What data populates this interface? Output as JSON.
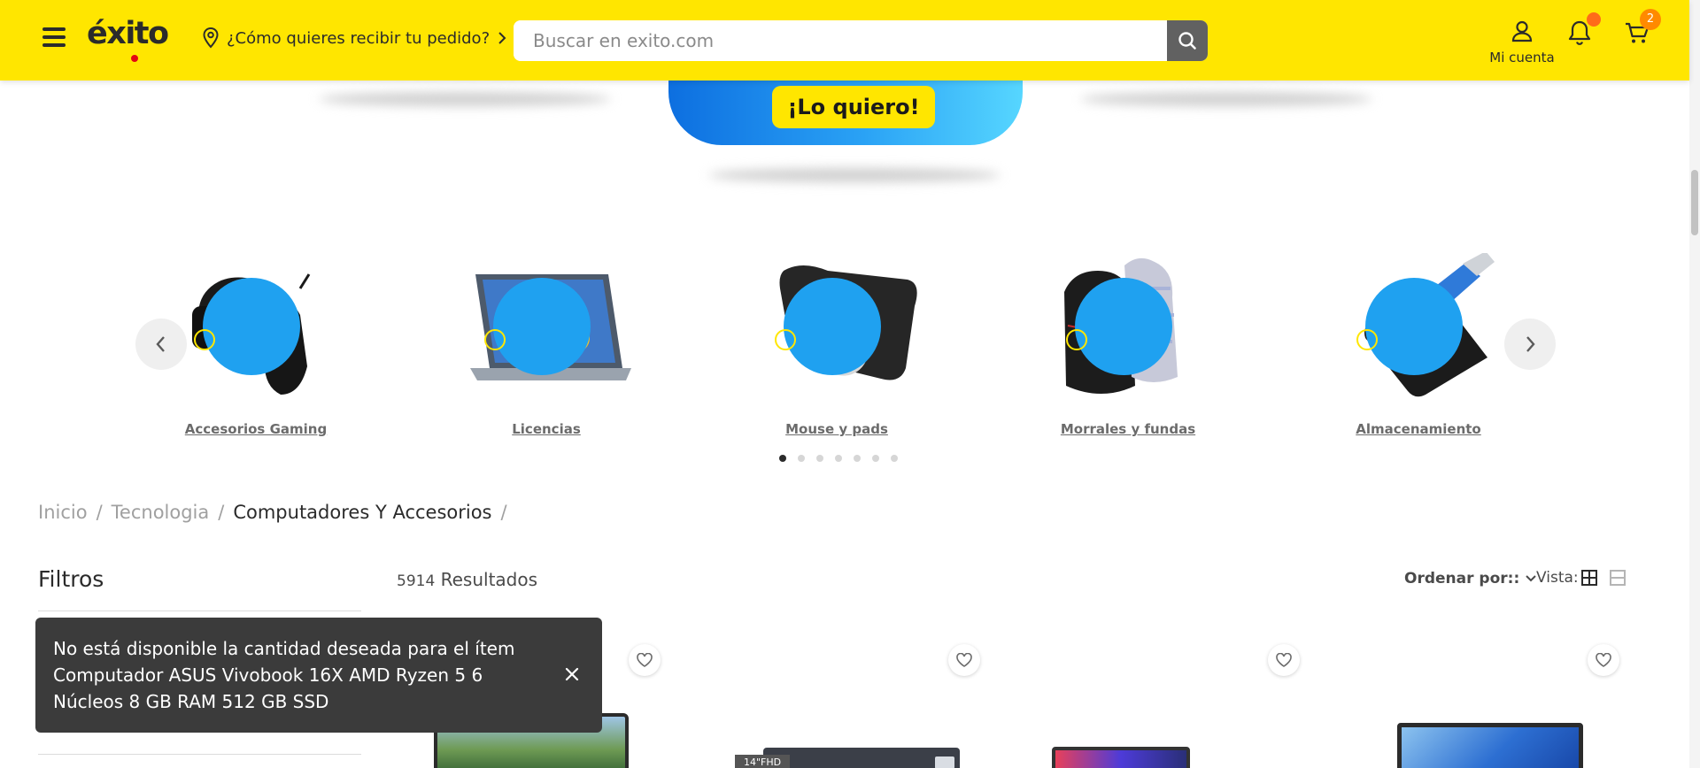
{
  "header": {
    "logo_text": "éxito",
    "delivery_label": "¿Cómo quieres recibir tu pedido?",
    "search_placeholder": "Buscar en exito.com",
    "account_label": "Mi cuenta",
    "cart_count": "2",
    "brand_color": "#ffe600"
  },
  "banner": {
    "button_label": "¡Lo quiero!"
  },
  "categories": [
    {
      "label": "Accesorios Gaming",
      "icon": "gaming-headset-mouse-icon"
    },
    {
      "label": "Licencias",
      "icon": "laptop-shield-icon"
    },
    {
      "label": "Mouse y pads",
      "icon": "mouse-pad-icon"
    },
    {
      "label": "Morrales y fundas",
      "icon": "backpack-icon"
    },
    {
      "label": "Almacenamiento",
      "icon": "external-drive-icon"
    }
  ],
  "carousel": {
    "page_count": 7,
    "active_page": 1
  },
  "breadcrumb": {
    "items": [
      "Inicio",
      "Tecnologia",
      "Computadores Y Accesorios"
    ],
    "separator": "/"
  },
  "filters": {
    "title": "Filtros"
  },
  "results": {
    "count": "5914",
    "label": "Resultados"
  },
  "toolbar": {
    "sort_label": "Ordenar por::",
    "view_label": "Vista:"
  },
  "products": [
    {
      "tag": ""
    },
    {
      "tag": "14\"FHD"
    },
    {
      "tag": ""
    },
    {
      "tag": ""
    }
  ],
  "toast": {
    "message": "No está disponible la cantidad deseada para el ítem Computador ASUS Vivobook 16X AMD Ryzen 5 6 Núcleos 8 GB RAM 512 GB SSD"
  }
}
